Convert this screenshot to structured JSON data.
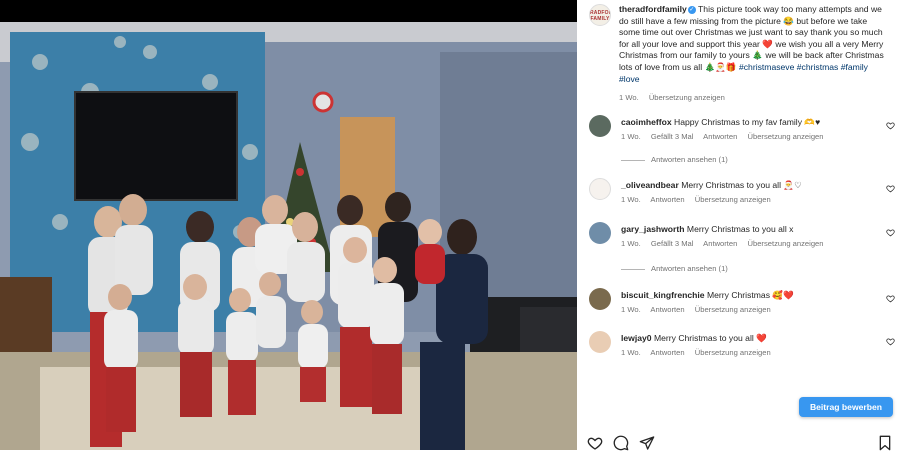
{
  "post": {
    "username": "theradfordfamily",
    "caption_main": "This picture took way too many attempts and we do still have a few missing from the picture 😂 but before we take some time out over Christmas we just want to say thank you so much for all your love and support this year ❤️ we wish you all a very Merry Christmas from our family to yours 🎄 we will be back after Christmas lots of love from us all 🎄🎅🎁",
    "hashtags": "#christmaseve #christmas #family #love",
    "time": "1 Wo.",
    "translate": "Übersetzung anzeigen",
    "avatar_text": "RADFORD FAMILY"
  },
  "comments": [
    {
      "username": "caoimheffox",
      "text": "Happy Christmas to my fav family 🫶♥",
      "time": "1 Wo.",
      "likes": "Gefällt 3 Mal",
      "reply": "Antworten",
      "translate": "Übersetzung anzeigen",
      "replies": "Antworten ansehen (1)"
    },
    {
      "username": "_oliveandbear",
      "text": "Merry Christmas to you all 🎅♡",
      "time": "1 Wo.",
      "reply": "Antworten",
      "translate": "Übersetzung anzeigen"
    },
    {
      "username": "gary_jashworth",
      "text": "Merry Christmas to you all x",
      "time": "1 Wo.",
      "likes": "Gefällt 3 Mal",
      "reply": "Antworten",
      "translate": "Übersetzung anzeigen",
      "replies": "Antworten ansehen (1)"
    },
    {
      "username": "biscuit_kingfrenchie",
      "text": "Merry Christmas 🥰❤️",
      "time": "1 Wo.",
      "reply": "Antworten",
      "translate": "Übersetzung anzeigen"
    },
    {
      "username": "lewjay0",
      "text": "Merry Christmas to you all ❤️",
      "time": "1 Wo.",
      "reply": "Antworten",
      "translate": "Übersetzung anzeigen"
    }
  ],
  "edit_button": "Beitrag bewerben",
  "icons": [
    "heart-icon",
    "comment-icon",
    "share-icon",
    "bookmark-icon",
    "verified-icon"
  ],
  "colors": {
    "accent": "#3897f0",
    "link": "#00376b",
    "meta": "#737373",
    "wall": "#7f8ea6"
  }
}
